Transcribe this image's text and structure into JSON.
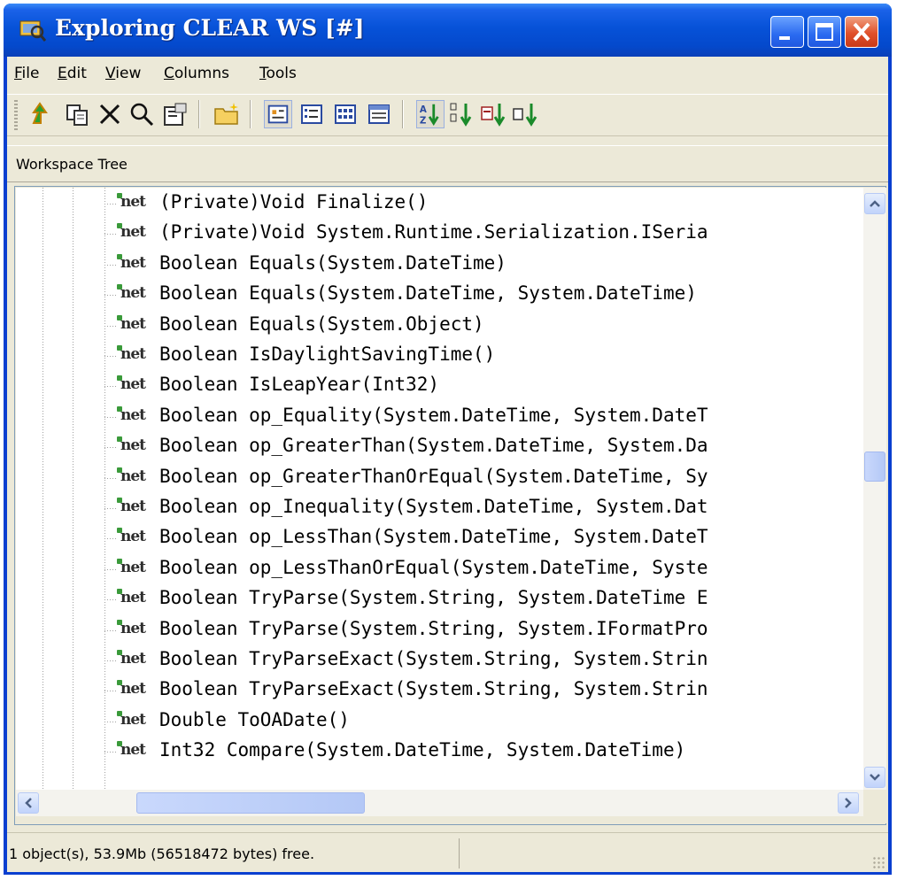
{
  "window": {
    "title": "Exploring CLEAR WS [#]",
    "accent_color": "#0a3fd0",
    "close_color": "#e0502a"
  },
  "menubar": {
    "items": [
      {
        "label": "File",
        "underline": "F",
        "rest": "ile"
      },
      {
        "label": "Edit",
        "underline": "E",
        "rest": "dit"
      },
      {
        "label": "View",
        "underline": "V",
        "rest": "iew"
      },
      {
        "label": "Columns",
        "underline": "C",
        "rest": "olumns"
      },
      {
        "label": "Tools",
        "underline": "T",
        "rest": "ools"
      }
    ]
  },
  "toolbar": {
    "icons": [
      "up-folder-icon",
      "copy-icon",
      "delete-icon",
      "search-icon",
      "properties-icon",
      "new-folder-icon",
      "large-icons-view-icon",
      "small-icons-view-icon",
      "list-view-icon",
      "details-view-icon",
      "sort-ascending-icon",
      "sort-by-type-icon",
      "sort-by-size-icon",
      "sort-by-date-icon"
    ]
  },
  "panel": {
    "header": "Workspace Tree"
  },
  "tree": {
    "icon_label": "net",
    "rows": [
      "(Private)Void Finalize()",
      "(Private)Void System.Runtime.Serialization.ISeria",
      "Boolean Equals(System.DateTime)",
      "Boolean Equals(System.DateTime, System.DateTime)",
      "Boolean Equals(System.Object)",
      "Boolean IsDaylightSavingTime()",
      "Boolean IsLeapYear(Int32)",
      "Boolean op_Equality(System.DateTime, System.DateT",
      "Boolean op_GreaterThan(System.DateTime, System.Da",
      "Boolean op_GreaterThanOrEqual(System.DateTime, Sy",
      "Boolean op_Inequality(System.DateTime, System.Dat",
      "Boolean op_LessThan(System.DateTime, System.DateT",
      "Boolean op_LessThanOrEqual(System.DateTime, Syste",
      "Boolean TryParse(System.String, System.DateTime E",
      "Boolean TryParse(System.String, System.IFormatPro",
      "Boolean TryParseExact(System.String, System.Strin",
      "Boolean TryParseExact(System.String, System.Strin",
      "Double ToOADate()",
      "Int32 Compare(System.DateTime, System.DateTime)"
    ]
  },
  "statusbar": {
    "text": "1 object(s), 53.9Mb (56518472 bytes) free."
  }
}
